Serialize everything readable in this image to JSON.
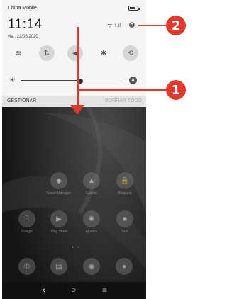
{
  "status_bar": {
    "carrier": "China Mobile",
    "battery_level": 0.7,
    "signal_icons": "ᯤ ↑.ıl"
  },
  "header": {
    "time": "11:14",
    "date": "vie., 22/05/2020"
  },
  "quick_settings": [
    {
      "name": "wifi-toggle",
      "icon": "wifi-icon",
      "glyph": "≋",
      "state": "off"
    },
    {
      "name": "mobile-data-toggle",
      "icon": "data-transfer-icon",
      "glyph": "⇅",
      "state": "on"
    },
    {
      "name": "sound-toggle",
      "icon": "volume-icon",
      "glyph": "◀",
      "state": "on"
    },
    {
      "name": "bluetooth-toggle",
      "icon": "bluetooth-icon",
      "glyph": "✱",
      "state": "off"
    },
    {
      "name": "auto-rotate-toggle",
      "icon": "rotate-icon",
      "glyph": "⟲",
      "state": "on"
    }
  ],
  "brightness": {
    "level": 0.58,
    "auto_label": "A"
  },
  "notification_footer": {
    "manage_label": "GESTIONAR",
    "clear_label": "BORRAR TODO"
  },
  "callouts": {
    "one": "1",
    "two": "2"
  },
  "home_apps": {
    "row1": [
      {
        "label": "Smart Manager",
        "icon": "shield-icon",
        "glyph": "◆"
      },
      {
        "label": "Galerie",
        "icon": "gallery-icon",
        "glyph": "▲"
      },
      {
        "label": "Bloqueur",
        "icon": "lock-icon",
        "glyph": "🔒"
      }
    ],
    "row2": [
      {
        "label": "Google",
        "icon": "google-folder-icon",
        "glyph": "⠿"
      },
      {
        "label": "Play Store",
        "icon": "play-store-icon",
        "glyph": "▶"
      },
      {
        "label": "Ajustes",
        "icon": "settings-icon",
        "glyph": "✺"
      },
      {
        "label": "Duo",
        "icon": "video-camera-icon",
        "glyph": "■"
      }
    ],
    "dock": [
      {
        "name": "phone-app",
        "icon": "phone-icon",
        "glyph": "✆"
      },
      {
        "name": "messages-app",
        "icon": "message-icon",
        "glyph": "▤"
      },
      {
        "name": "chrome-app",
        "icon": "chrome-icon",
        "glyph": "◉"
      },
      {
        "name": "camera-app",
        "icon": "camera-icon",
        "glyph": "●"
      }
    ]
  },
  "nav_bar": {
    "back": "‹",
    "home": "○",
    "recents": "≡"
  },
  "colors": {
    "accent": "#e03a2f",
    "shade_bg": "#f5f5f5",
    "homescreen_bg": "#1e1e1e"
  }
}
